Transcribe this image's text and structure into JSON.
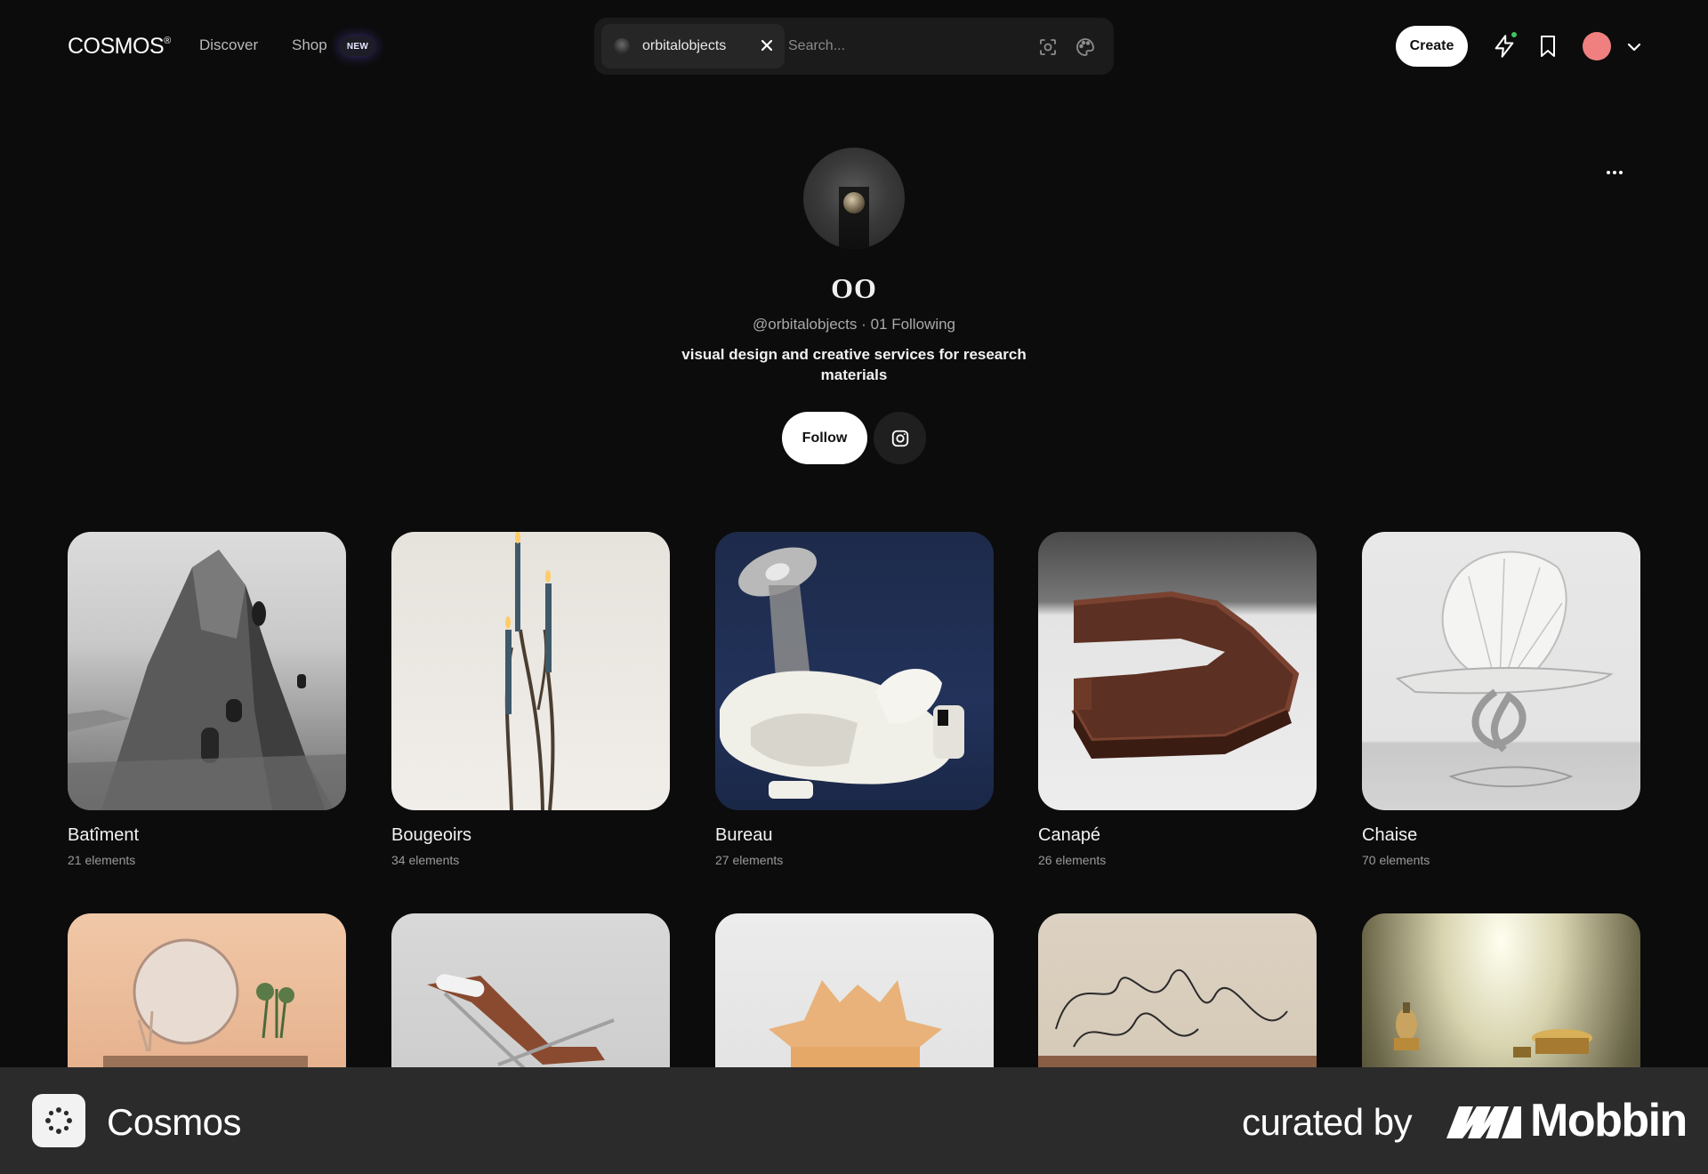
{
  "header": {
    "logo": "COSMOS",
    "logo_mark": "®",
    "nav": {
      "discover": "Discover",
      "shop": "Shop",
      "new_badge": "NEW"
    },
    "search": {
      "chip_label": "orbitalobjects",
      "placeholder": "Search...",
      "close_icon": "close-icon",
      "scan_icon": "scan-icon",
      "palette_icon": "palette-icon"
    },
    "create_label": "Create",
    "icons": {
      "notifications": "bolt-icon",
      "saved": "bookmark-icon",
      "menu": "chevron-down-icon"
    },
    "notification_dot_color": "#43c35e",
    "avatar_color": "#f08080"
  },
  "profile": {
    "name": "OO",
    "handle": "@orbitalobjects",
    "separator": "·",
    "following": "01 Following",
    "bio": "visual design and creative services for research materials",
    "follow_label": "Follow",
    "instagram_icon": "instagram-icon",
    "more_icon": "more-icon"
  },
  "clusters": [
    {
      "title": "Batîment",
      "count": "21 elements"
    },
    {
      "title": "Bougeoirs",
      "count": "34 elements"
    },
    {
      "title": "Bureau",
      "count": "27 elements"
    },
    {
      "title": "Canapé",
      "count": "26 elements"
    },
    {
      "title": "Chaise",
      "count": "70 elements"
    }
  ],
  "banner": {
    "app_name": "Cosmos",
    "curated_by": "curated by",
    "brand": "Mobbin"
  }
}
